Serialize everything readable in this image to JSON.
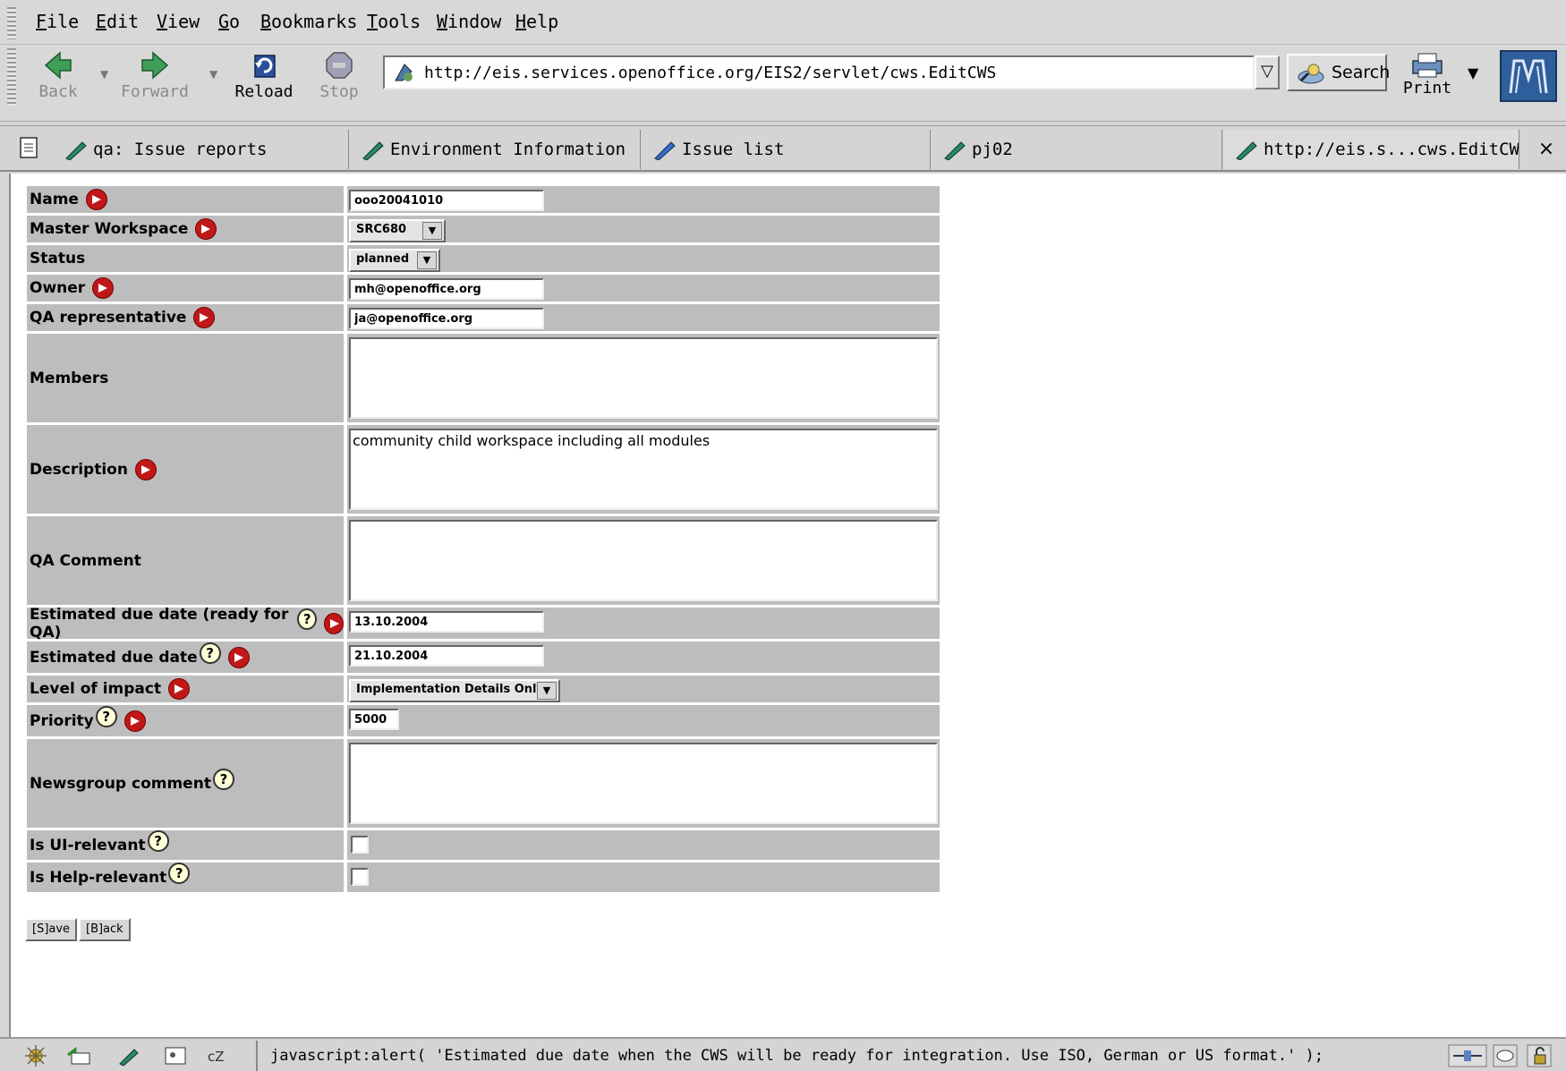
{
  "menu": [
    {
      "accel": "F",
      "rest": "ile"
    },
    {
      "accel": "E",
      "rest": "dit"
    },
    {
      "accel": "V",
      "rest": "iew"
    },
    {
      "accel": "G",
      "rest": "o"
    },
    {
      "accel": "B",
      "rest": "ookmarks"
    },
    {
      "accel": "T",
      "rest": "ools"
    },
    {
      "accel": "W",
      "rest": "indow"
    },
    {
      "accel": "H",
      "rest": "elp"
    }
  ],
  "toolbar": {
    "back": "Back",
    "forward": "Forward",
    "reload": "Reload",
    "stop": "Stop",
    "url": "http://eis.services.openoffice.org/EIS2/servlet/cws.EditCWS",
    "search": "Search",
    "print": "Print"
  },
  "tabs": [
    {
      "label": "qa: Issue reports"
    },
    {
      "label": "Environment Information ..."
    },
    {
      "label": "Issue list"
    },
    {
      "label": "pj02"
    },
    {
      "label": "http://eis.s...cws.EditCWS"
    }
  ],
  "tab_close": "×",
  "form": {
    "name_label": "Name",
    "name_value": "ooo20041010",
    "master_label": "Master Workspace",
    "master_value": "SRC680",
    "status_label": "Status",
    "status_value": "planned",
    "owner_label": "Owner",
    "owner_value": "mh@openoffice.org",
    "qa_rep_label": "QA representative",
    "qa_rep_value": "ja@openoffice.org",
    "members_label": "Members",
    "members_value": "",
    "description_label": "Description",
    "description_value": "community child workspace including all modules",
    "qa_comment_label": "QA Comment",
    "qa_comment_value": "",
    "due_qa_label": "Estimated due date (ready for QA)",
    "due_qa_value": "13.10.2004",
    "due_label": "Estimated due date",
    "due_value": "21.10.2004",
    "impact_label": "Level of impact",
    "impact_value": "Implementation Details Only",
    "priority_label": "Priority",
    "priority_value": "5000",
    "newsgroup_label": "Newsgroup comment",
    "newsgroup_value": "",
    "ui_relevant_label": "Is UI-relevant",
    "help_relevant_label": "Is Help-relevant",
    "help_glyph": "?",
    "select_arrow": "▼",
    "save_button": "[S]ave",
    "back_button": "[B]ack"
  },
  "status": {
    "text": "javascript:alert( 'Estimated due date when the CWS will be ready for integration. Use ISO, German or US format.' );"
  }
}
